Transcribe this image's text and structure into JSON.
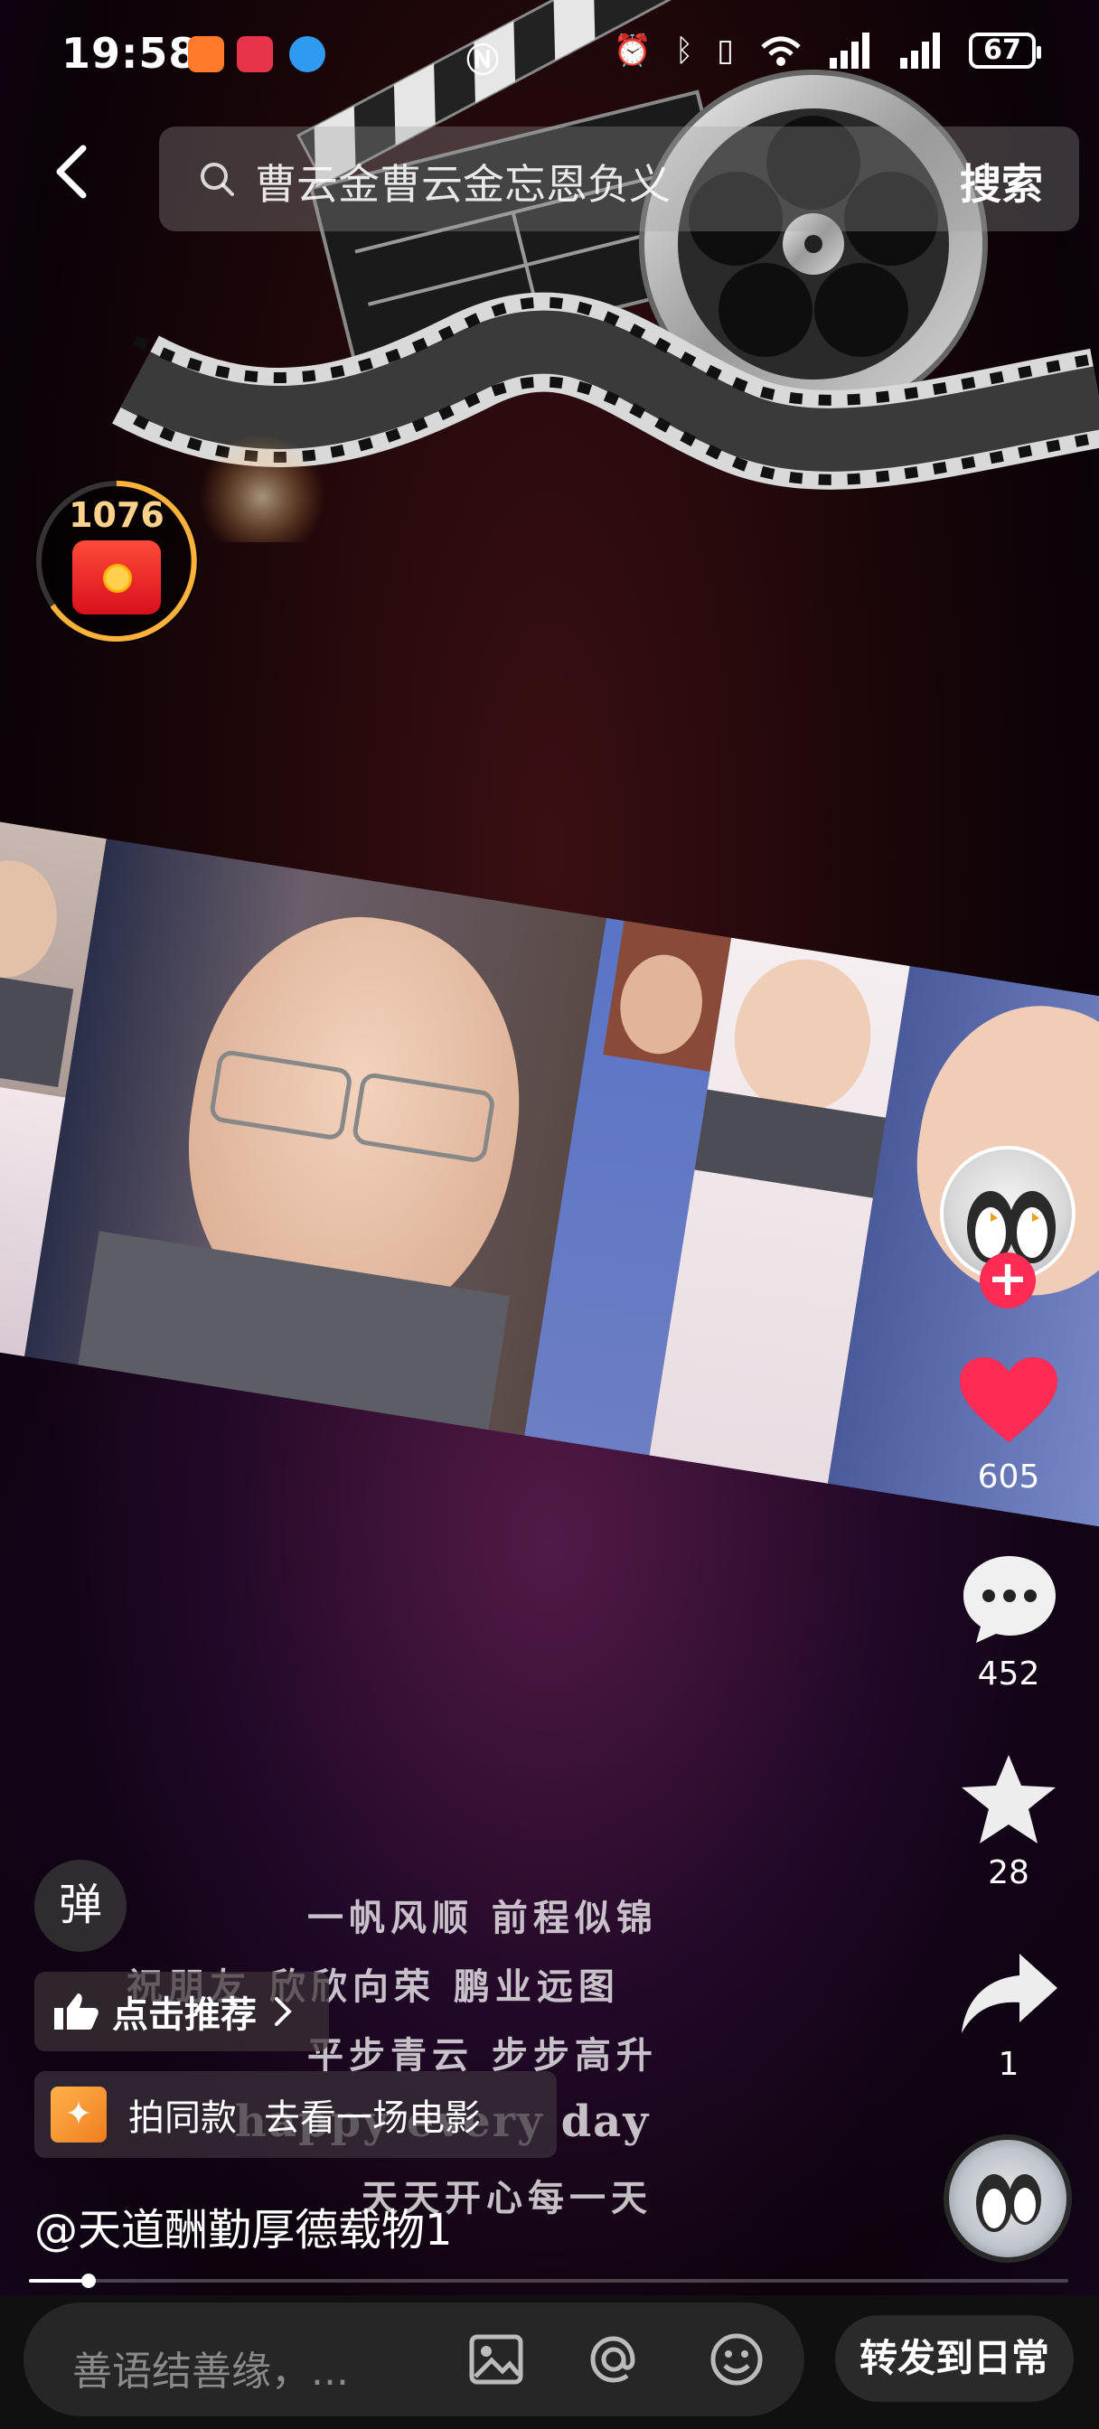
{
  "status_bar": {
    "time": "19:58",
    "battery": "67"
  },
  "search": {
    "query": "曹云金曹云金忘恩负义",
    "submit_label": "搜索"
  },
  "red_packet": {
    "count": "1076"
  },
  "actions": {
    "likes": "605",
    "comments": "452",
    "favorites": "28",
    "shares": "1",
    "like_color": "#fe2c55"
  },
  "overlay": {
    "danmu_label": "弹",
    "recommend_label": "点击推荐",
    "same_label": "拍同款",
    "same_movie": "去看一场电影",
    "author": "@天道酬勤厚德载物1"
  },
  "lyrics": [
    "一帆风顺  前程似锦",
    "祝朋友  欣欣向荣  鹏业远图",
    "平步青云  步步高升",
    "happy every day",
    "天天开心每一天"
  ],
  "progress": {
    "played_fraction": 0.057
  },
  "bottom_bar": {
    "comment_placeholder": "善语结善缘，...",
    "share_label": "转发到日常"
  }
}
